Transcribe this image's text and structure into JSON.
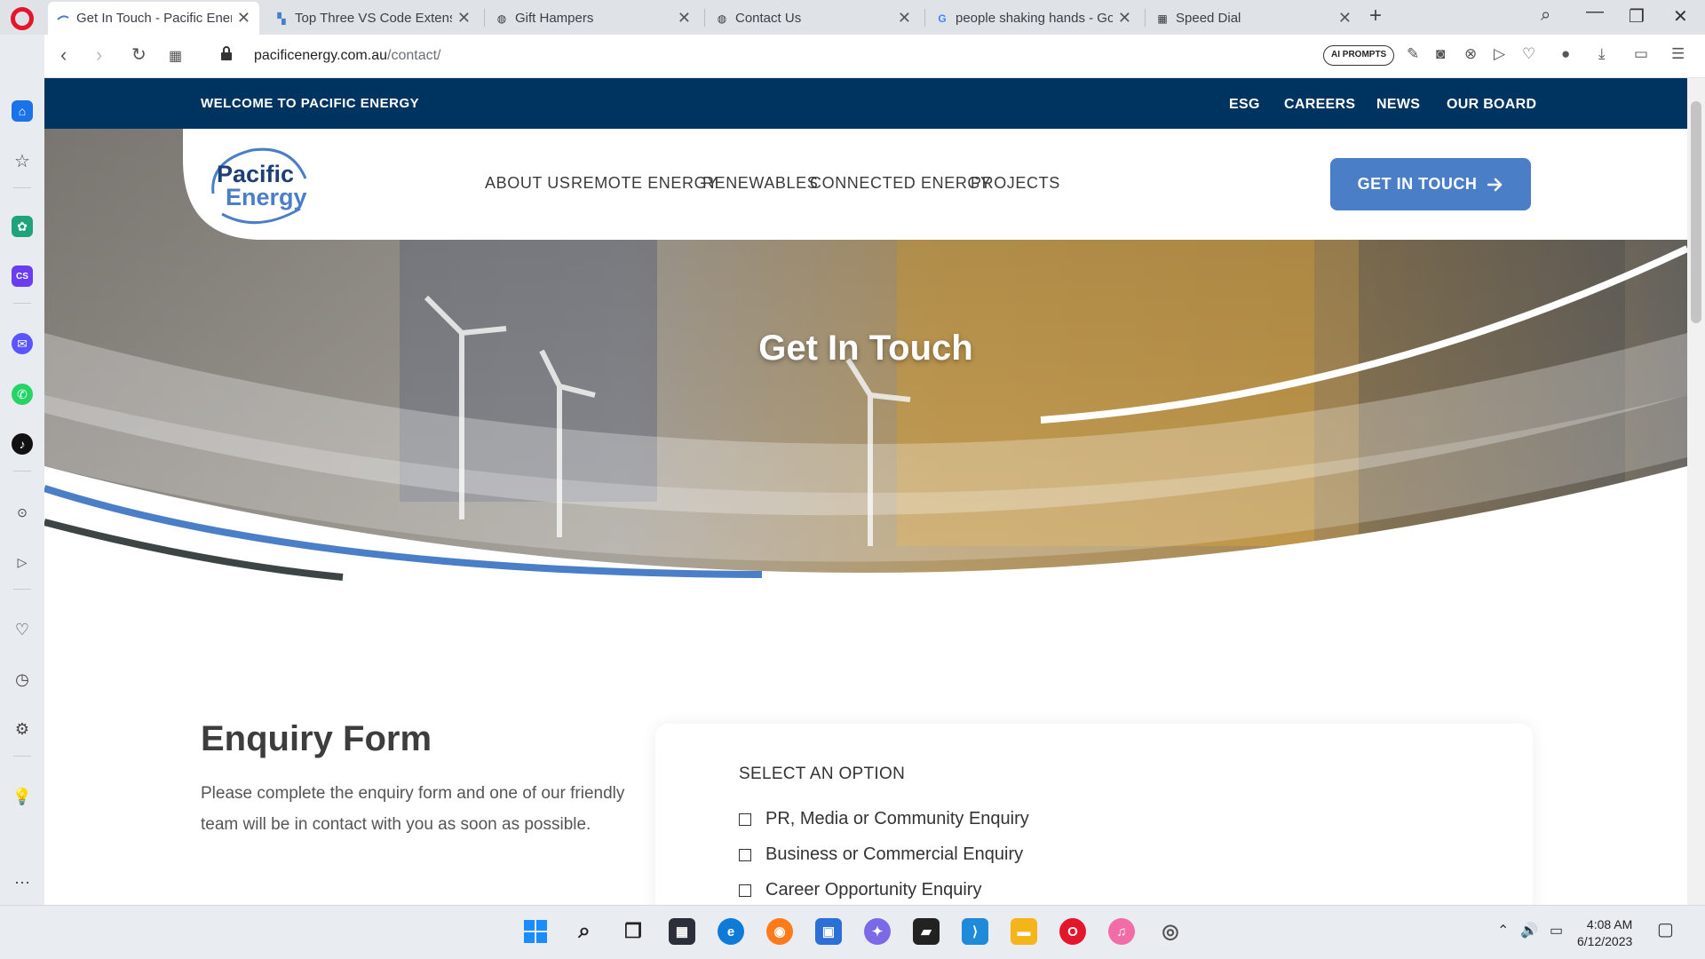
{
  "browser": {
    "tabs": [
      {
        "title": "Get In Touch - Pacific Energy",
        "active": true,
        "icon": "pacific-energy-favicon"
      },
      {
        "title": "Top Three VS Code Extensions",
        "active": false,
        "icon": "page-favicon"
      },
      {
        "title": "Gift Hampers",
        "active": false,
        "icon": "globe-icon"
      },
      {
        "title": "Contact Us",
        "active": false,
        "icon": "globe-icon"
      },
      {
        "title": "people shaking hands - Google",
        "active": false,
        "icon": "google-icon"
      },
      {
        "title": "Speed Dial",
        "active": false,
        "icon": "grid-icon"
      }
    ],
    "url_host": "pacificenergy.com.au",
    "url_path": "/contact/",
    "ai_prompts_label": "AI PROMPTS"
  },
  "site": {
    "welcome": "WELCOME TO PACIFIC ENERGY",
    "top_links": [
      "ESG",
      "CAREERS",
      "NEWS",
      "OUR BOARD"
    ],
    "logo_line1": "Pacific",
    "logo_line2": "Energy",
    "menu": [
      "ABOUT US",
      "REMOTE ENERGY",
      "RENEWABLES",
      "CONNECTED ENERGY",
      "PROJECTS"
    ],
    "cta_label": "GET IN TOUCH",
    "hero_title": "Get In Touch",
    "enquiry_heading": "Enquiry Form",
    "enquiry_text": "Please complete the enquiry form and one of our friendly team will be in contact with you as soon as possible.",
    "form_label": "SELECT AN OPTION",
    "options": [
      "PR, Media or Community Enquiry",
      "Business or Commercial Enquiry",
      "Career Opportunity Enquiry"
    ]
  },
  "colors": {
    "navy": "#003460",
    "brand_blue": "#4a7ec6",
    "dark_grey": "#3d4444"
  },
  "taskbar": {
    "time": "4:08 AM",
    "date": "6/12/2023"
  }
}
